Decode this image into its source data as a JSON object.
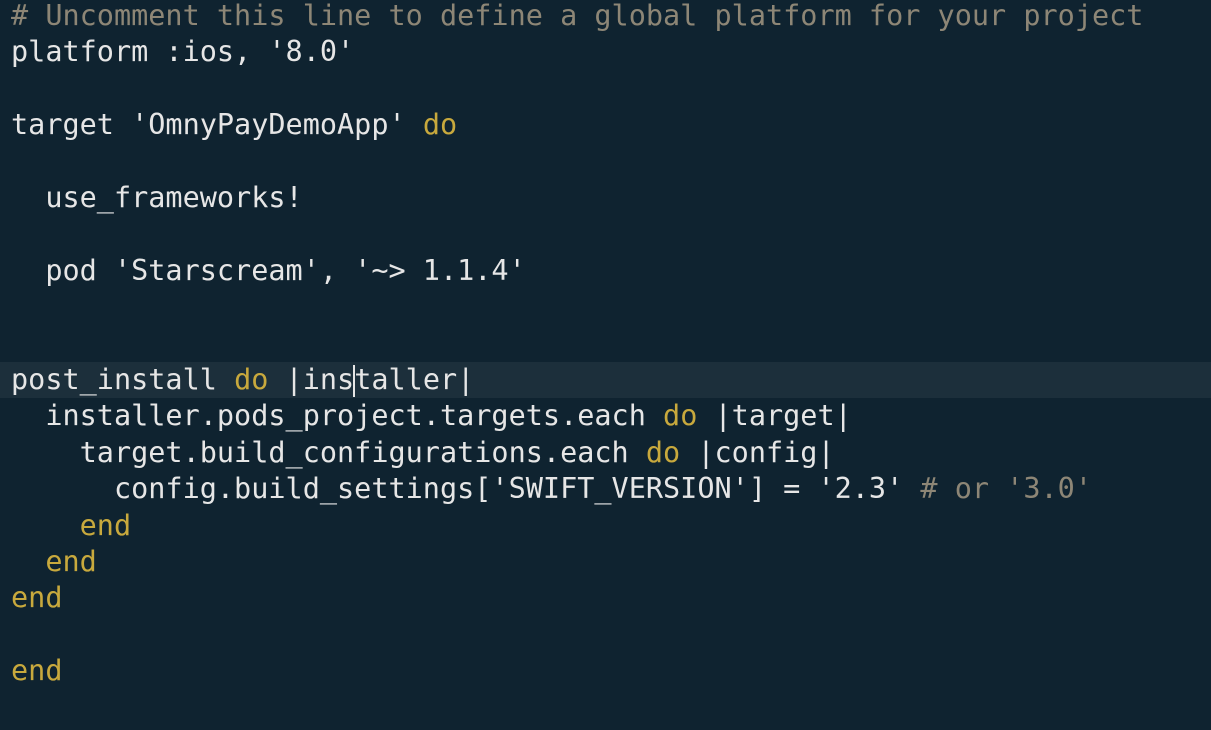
{
  "editor": {
    "lines": [
      [
        {
          "t": "# Uncomment this line to define a global platform for your project",
          "c": "comment"
        }
      ],
      [
        {
          "t": "platform :ios, '8.0'",
          "c": "plain"
        }
      ],
      [],
      [
        {
          "t": "target 'OmnyPayDemoApp' ",
          "c": "plain"
        },
        {
          "t": "do",
          "c": "kw"
        }
      ],
      [],
      [
        {
          "t": "  use_frameworks!",
          "c": "plain"
        }
      ],
      [],
      [
        {
          "t": "  pod 'Starscream', '~> 1.1.4'",
          "c": "plain"
        }
      ],
      [],
      [],
      [
        {
          "t": "post_install ",
          "c": "plain"
        },
        {
          "t": "do",
          "c": "kw"
        },
        {
          "t": " |ins",
          "c": "plain"
        },
        {
          "cursor": true
        },
        {
          "t": "taller|",
          "c": "plain"
        }
      ],
      [
        {
          "t": "  installer.pods_project.targets.each ",
          "c": "plain"
        },
        {
          "t": "do",
          "c": "kw"
        },
        {
          "t": " |target|",
          "c": "plain"
        }
      ],
      [
        {
          "t": "    target.build_configurations.each ",
          "c": "plain"
        },
        {
          "t": "do",
          "c": "kw"
        },
        {
          "t": " |config|",
          "c": "plain"
        }
      ],
      [
        {
          "t": "      config.build_settings['SWIFT_VERSION'] = '2.3' ",
          "c": "plain"
        },
        {
          "t": "# or '3.0'",
          "c": "comment"
        }
      ],
      [
        {
          "t": "    ",
          "c": "plain"
        },
        {
          "t": "end",
          "c": "kw"
        }
      ],
      [
        {
          "t": "  ",
          "c": "plain"
        },
        {
          "t": "end",
          "c": "kw"
        }
      ],
      [
        {
          "t": "end",
          "c": "kw"
        }
      ],
      [],
      [
        {
          "t": "end",
          "c": "kw"
        }
      ]
    ],
    "current_line_index": 10
  }
}
